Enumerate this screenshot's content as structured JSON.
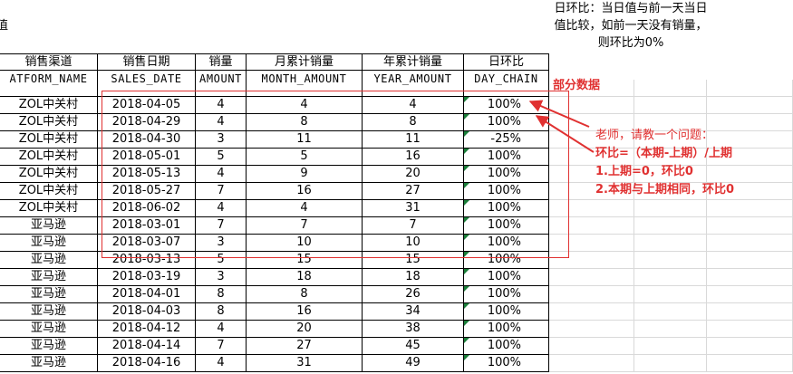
{
  "top_left_fragment": "值",
  "note_text": "日环比：当日值与前一天当日值比较，如前一天没有销量，则环比为0%",
  "header_cn": [
    "销售渠道",
    "销售日期",
    "销量",
    "月累计销量",
    "年累计销量",
    "日环比"
  ],
  "header_en": [
    "ATFORM_NAME",
    "SALES_DATE",
    "AMOUNT",
    "MONTH_AMOUNT",
    "YEAR_AMOUNT",
    "DAY_CHAIN"
  ],
  "partial_label": "部分数据",
  "comment": {
    "line1": "老师，请教一个问题：",
    "line2": "环比=（本期-上期）/上期",
    "line3": "1.上期=0，环比0",
    "line4": "2.本期与上期相同，环比0"
  },
  "rows": [
    [
      "ZOL中关村",
      "2018-04-05",
      "4",
      "4",
      "4",
      "100%"
    ],
    [
      "ZOL中关村",
      "2018-04-29",
      "4",
      "8",
      "8",
      "100%"
    ],
    [
      "ZOL中关村",
      "2018-04-30",
      "3",
      "11",
      "11",
      "-25%"
    ],
    [
      "ZOL中关村",
      "2018-05-01",
      "5",
      "5",
      "16",
      "100%"
    ],
    [
      "ZOL中关村",
      "2018-05-13",
      "4",
      "9",
      "20",
      "100%"
    ],
    [
      "ZOL中关村",
      "2018-05-27",
      "7",
      "16",
      "27",
      "100%"
    ],
    [
      "ZOL中关村",
      "2018-06-02",
      "4",
      "4",
      "31",
      "100%"
    ],
    [
      "亚马逊",
      "2018-03-01",
      "7",
      "7",
      "7",
      "100%"
    ],
    [
      "亚马逊",
      "2018-03-07",
      "3",
      "10",
      "10",
      "100%"
    ],
    [
      "亚马逊",
      "2018-03-13",
      "5",
      "15",
      "15",
      "100%"
    ],
    [
      "亚马逊",
      "2018-03-19",
      "3",
      "18",
      "18",
      "100%"
    ],
    [
      "亚马逊",
      "2018-04-01",
      "8",
      "8",
      "26",
      "100%"
    ],
    [
      "亚马逊",
      "2018-04-03",
      "8",
      "16",
      "34",
      "100%"
    ],
    [
      "亚马逊",
      "2018-04-12",
      "4",
      "20",
      "38",
      "100%"
    ],
    [
      "亚马逊",
      "2018-04-14",
      "7",
      "27",
      "45",
      "100%"
    ],
    [
      "亚马逊",
      "2018-04-16",
      "4",
      "31",
      "49",
      "100%"
    ]
  ],
  "colors": {
    "annotation": "#e03131",
    "flag": "#1b7f3a"
  }
}
